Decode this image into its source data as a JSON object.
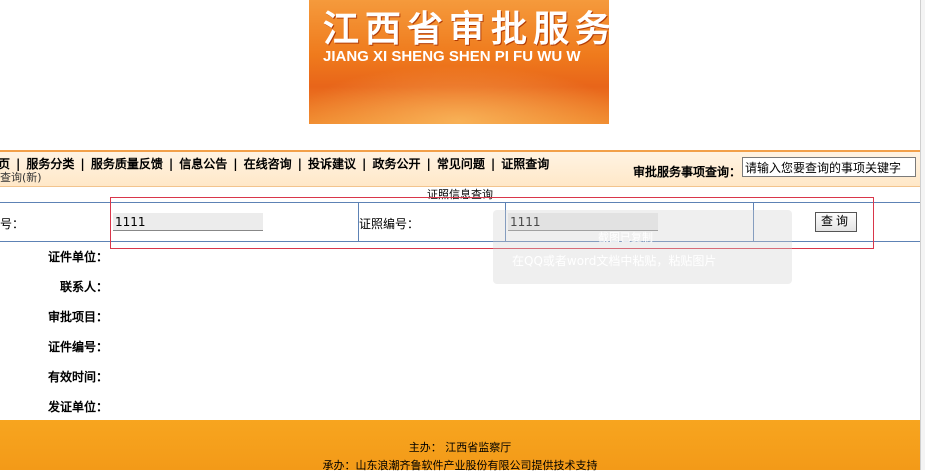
{
  "banner": {
    "title_cn": "江西省审批服务",
    "title_en": "JIANG XI SHENG SHEN PI FU WU W"
  },
  "nav": {
    "items": [
      "首页",
      "服务分类",
      "服务质量反馈",
      "信息公告",
      "在线咨询",
      "投诉建议",
      "政务公开",
      "常见问题",
      "证照查询"
    ],
    "sub_link": "查询(新)",
    "search_label": "审批服务事项查询：",
    "search_placeholder": "请输入您要查询的事项关键字"
  },
  "query": {
    "title": "证照信息查询",
    "field1_label": "号：",
    "field1_value": "1111",
    "field2_label": "证照编号：",
    "field2_value": "1111",
    "submit_label": "查询"
  },
  "tooltip": {
    "line1": "截图已复制",
    "line2": "在QQ或者word文档中粘贴，粘贴图片"
  },
  "results": {
    "labels": [
      "证件单位：",
      "联系人：",
      "审批项目：",
      "证件编号：",
      "有效时间：",
      "发证单位："
    ]
  },
  "footer": {
    "host": "主办： 江西省监察厅",
    "support": "承办：山东浪潮齐鲁软件产业股份有限公司提供技术支持"
  },
  "colors": {
    "nav_bg": "#ffe8c8",
    "footer_bg": "#f6a21e",
    "table_border": "#5d82b5",
    "highlight_box": "#d9364a"
  }
}
